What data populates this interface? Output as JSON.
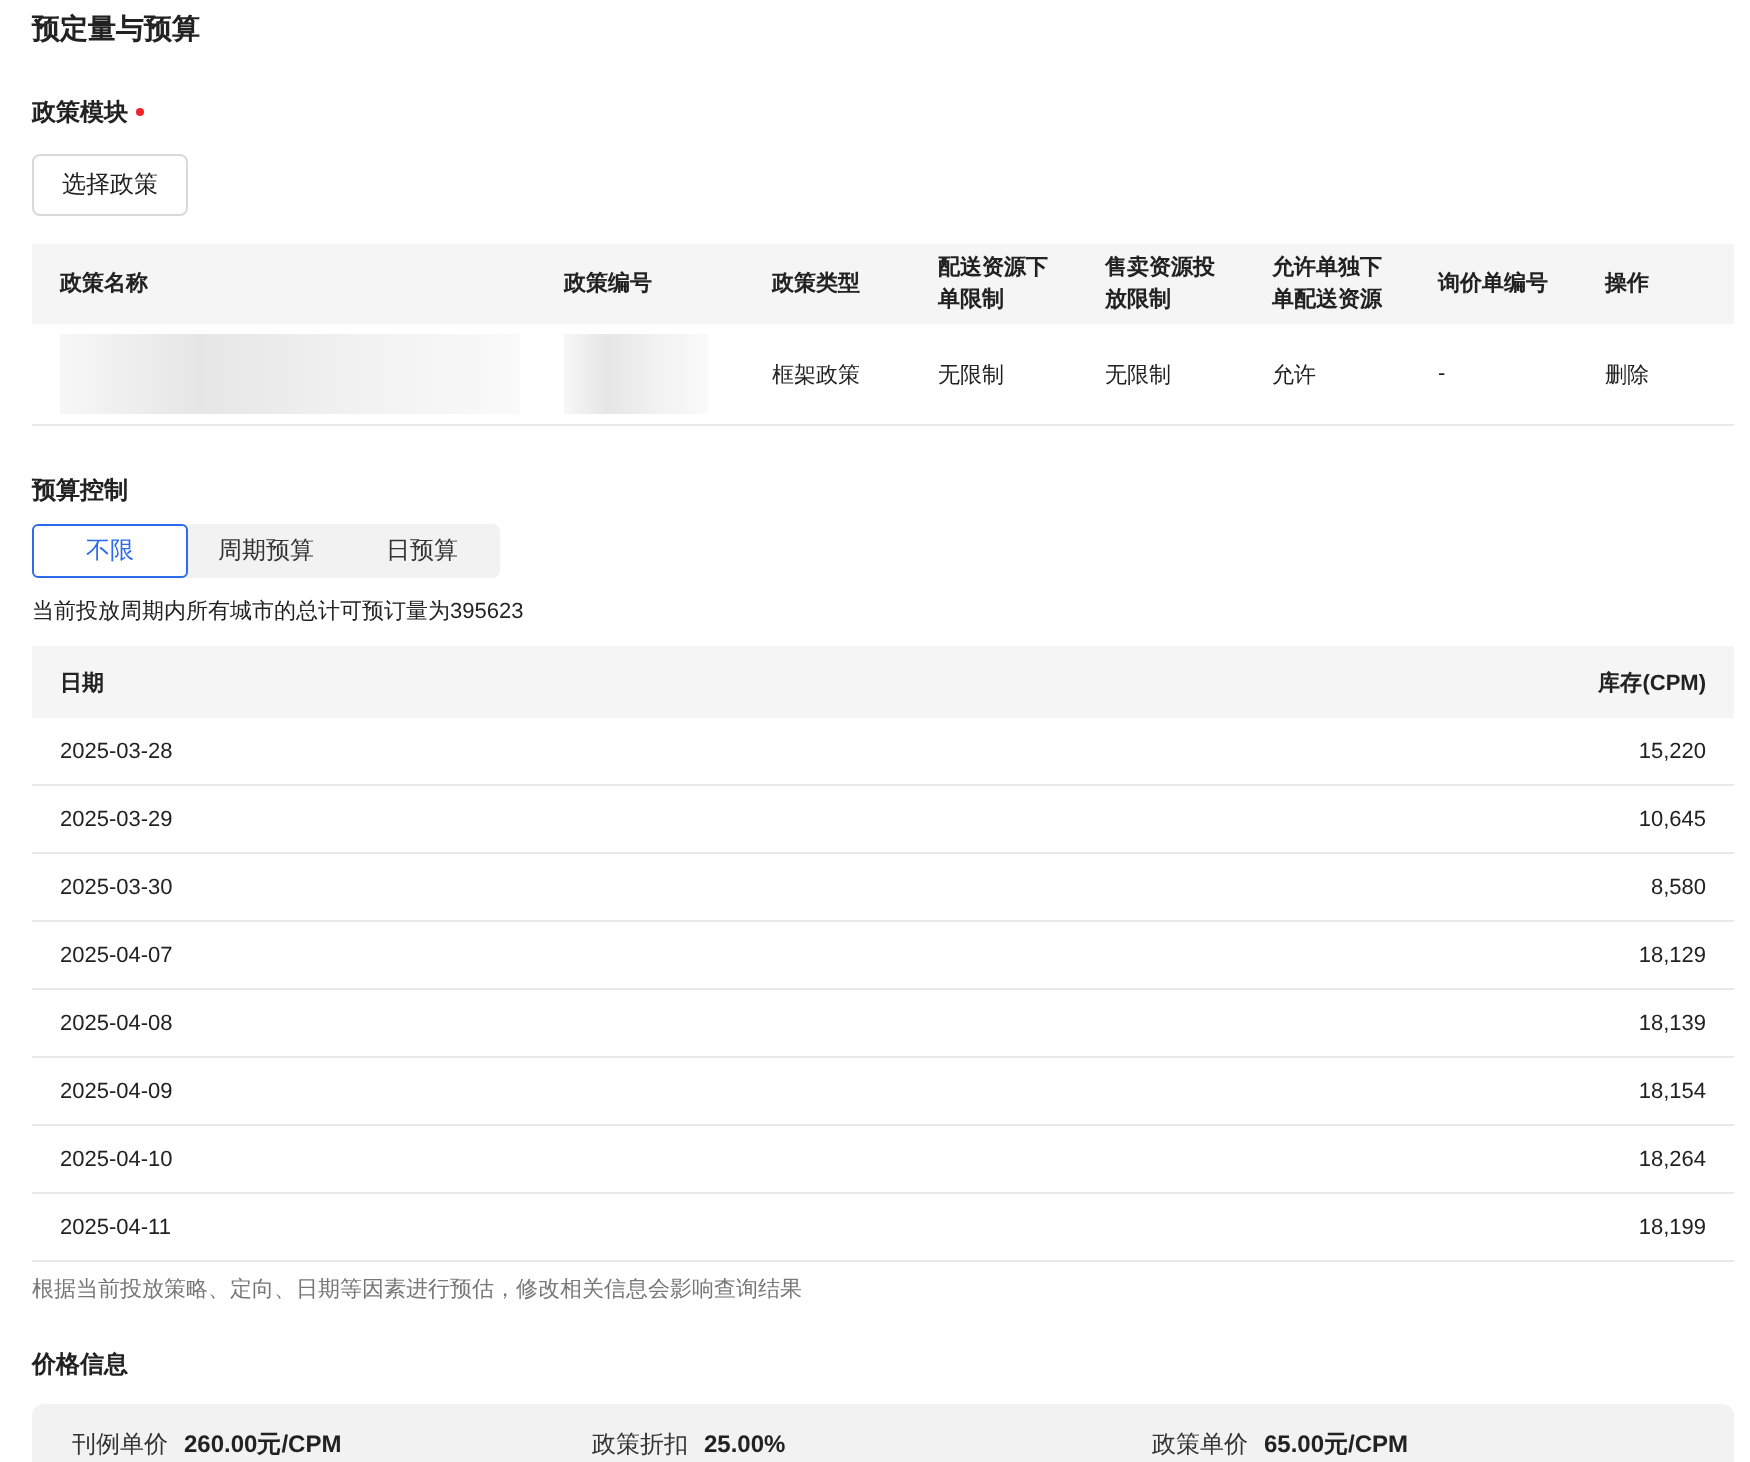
{
  "title": "预定量与预算",
  "policy_section": {
    "label": "政策模块",
    "required": true,
    "button": "选择政策",
    "columns": [
      "政策名称",
      "政策编号",
      "政策类型",
      "配送资源下单限制",
      "售卖资源投放限制",
      "允许单独下单配送资源",
      "询价单编号",
      "操作"
    ],
    "rows": [
      {
        "name_redacted": true,
        "number_redacted": true,
        "type": "框架政策",
        "delivery_limit": "无限制",
        "sale_limit": "无限制",
        "allow_separate": "允许",
        "inquiry_no": "-",
        "action": "删除"
      }
    ]
  },
  "budget_section": {
    "label": "预算控制",
    "options": [
      {
        "label": "不限",
        "selected": true
      },
      {
        "label": "周期预算",
        "selected": false
      },
      {
        "label": "日预算",
        "selected": false
      }
    ],
    "summary": "当前投放周期内所有城市的总计可预订量为395623",
    "columns": [
      "日期",
      "库存(CPM)"
    ],
    "rows": [
      {
        "date": "2025-03-28",
        "stock": "15,220"
      },
      {
        "date": "2025-03-29",
        "stock": "10,645"
      },
      {
        "date": "2025-03-30",
        "stock": "8,580"
      },
      {
        "date": "2025-04-07",
        "stock": "18,129"
      },
      {
        "date": "2025-04-08",
        "stock": "18,139"
      },
      {
        "date": "2025-04-09",
        "stock": "18,154"
      },
      {
        "date": "2025-04-10",
        "stock": "18,264"
      },
      {
        "date": "2025-04-11",
        "stock": "18,199"
      }
    ],
    "note": "根据当前投放策略、定向、日期等因素进行预估，修改相关信息会影响查询结果"
  },
  "price_section": {
    "label": "价格信息",
    "items": [
      {
        "label": "刊例单价",
        "value": "260.00元/CPM"
      },
      {
        "label": "政策折扣",
        "value": "25.00%"
      },
      {
        "label": "政策单价",
        "value": "65.00元/CPM"
      }
    ]
  }
}
